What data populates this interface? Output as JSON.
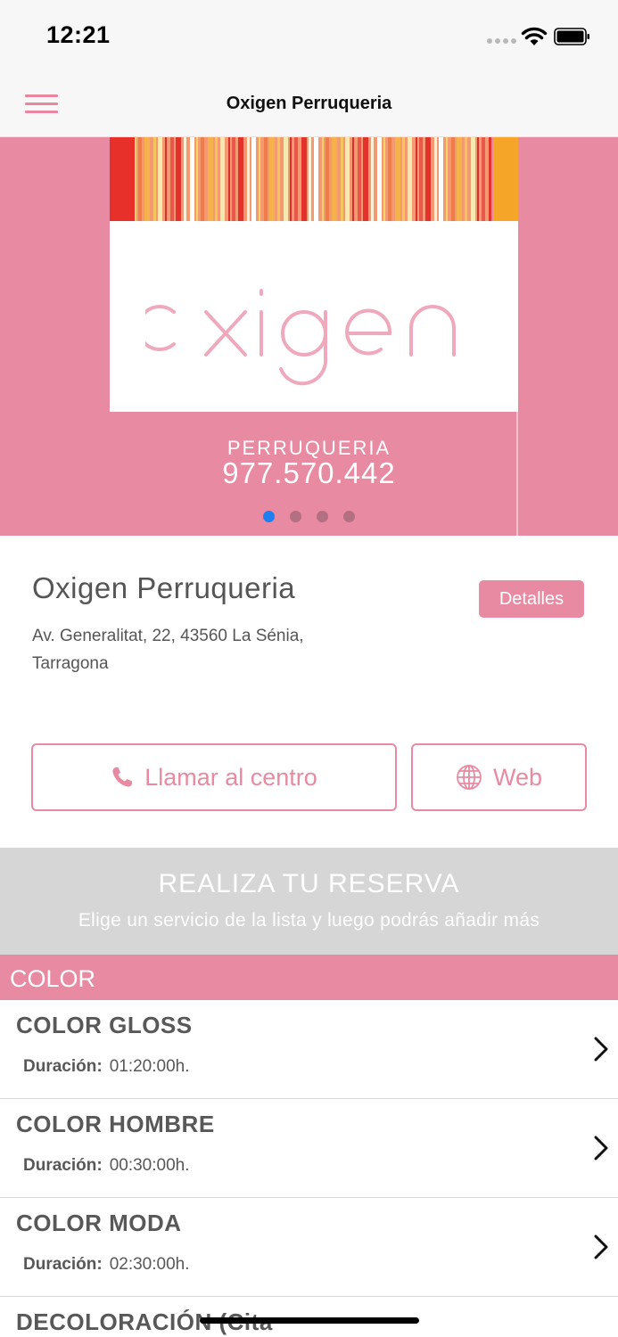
{
  "status_bar": {
    "time": "12:21"
  },
  "nav": {
    "title": "Oxigen Perruqueria",
    "menu_icon": "hamburger-icon"
  },
  "carousel": {
    "logo_text": "oxigen",
    "label": "PERRUQUERIA",
    "phone": "977.570.442",
    "slide_count": 4,
    "active_slide": 1
  },
  "center": {
    "name": "Oxigen Perruqueria",
    "details_label": "Detalles",
    "address_line1": "Av. Generalitat, 22, 43560 La Sénia,",
    "address_line2": "Tarragona",
    "call_label": "Llamar al centro",
    "web_label": "Web"
  },
  "booking": {
    "title": "REALIZA TU RESERVA",
    "subtitle": "Elige un servicio de la lista y luego podrás añadir más"
  },
  "category": {
    "title": "COLOR"
  },
  "services": [
    {
      "name": "COLOR GLOSS",
      "duration_label": "Duración:",
      "duration": "01:20:00h."
    },
    {
      "name": "COLOR HOMBRE",
      "duration_label": "Duración:",
      "duration": "00:30:00h."
    },
    {
      "name": "COLOR MODA",
      "duration_label": "Duración:",
      "duration": "02:30:00h."
    },
    {
      "name": "DECOLORACIÓN (Cita",
      "duration_label": "",
      "duration": ""
    }
  ],
  "colors": {
    "accent": "#e88aa1",
    "booking_bg": "#d6d6d6",
    "active_dot": "#1f7ef0"
  }
}
